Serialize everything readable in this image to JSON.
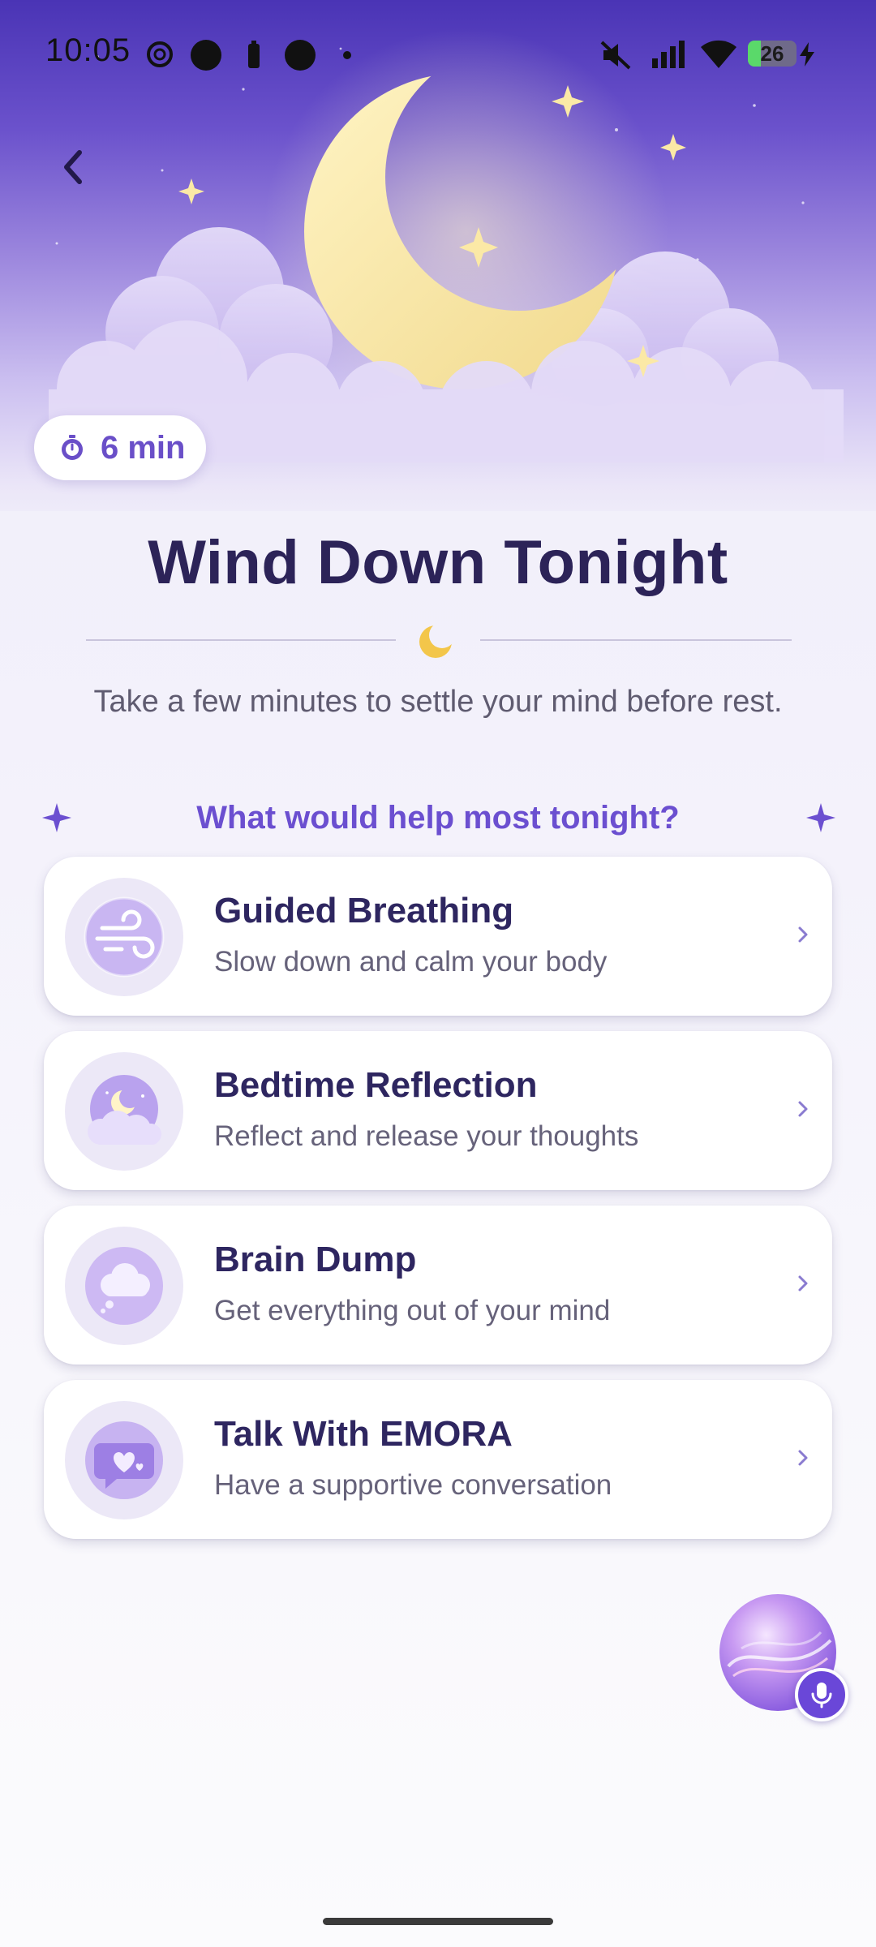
{
  "status_bar": {
    "time": "10:05",
    "battery_percent": "26",
    "icons": [
      "openai-icon",
      "record-icon",
      "battery-saver-icon",
      "record-icon",
      "dot-icon",
      "mute-icon",
      "signal-icon",
      "wifi-icon",
      "battery-icon",
      "charging-icon"
    ]
  },
  "header": {
    "back_icon": "chevron-left-icon",
    "duration": "6 min",
    "duration_icon": "timer-icon"
  },
  "main": {
    "title": "Wind Down Tonight",
    "divider_icon": "crescent-moon-icon",
    "subtitle": "Take a few minutes to settle your mind before rest.",
    "question": "What would help most tonight?",
    "options": [
      {
        "title": "Guided Breathing",
        "description": "Slow down and calm your body",
        "icon": "wind-icon"
      },
      {
        "title": "Bedtime Reflection",
        "description": "Reflect and release your thoughts",
        "icon": "moon-cloud-icon"
      },
      {
        "title": "Brain Dump",
        "description": "Get everything out of your mind",
        "icon": "thought-cloud-icon"
      },
      {
        "title": "Talk With EMORA",
        "description": "Have a supportive conversation",
        "icon": "heart-chat-icon"
      }
    ]
  },
  "assistant": {
    "orb_icon": "emora-orb-icon",
    "mic_icon": "microphone-icon"
  },
  "colors": {
    "accent": "#6b4fd0",
    "title": "#2c2358",
    "hero_top": "#4a34b5",
    "card_bg": "#ffffff"
  }
}
